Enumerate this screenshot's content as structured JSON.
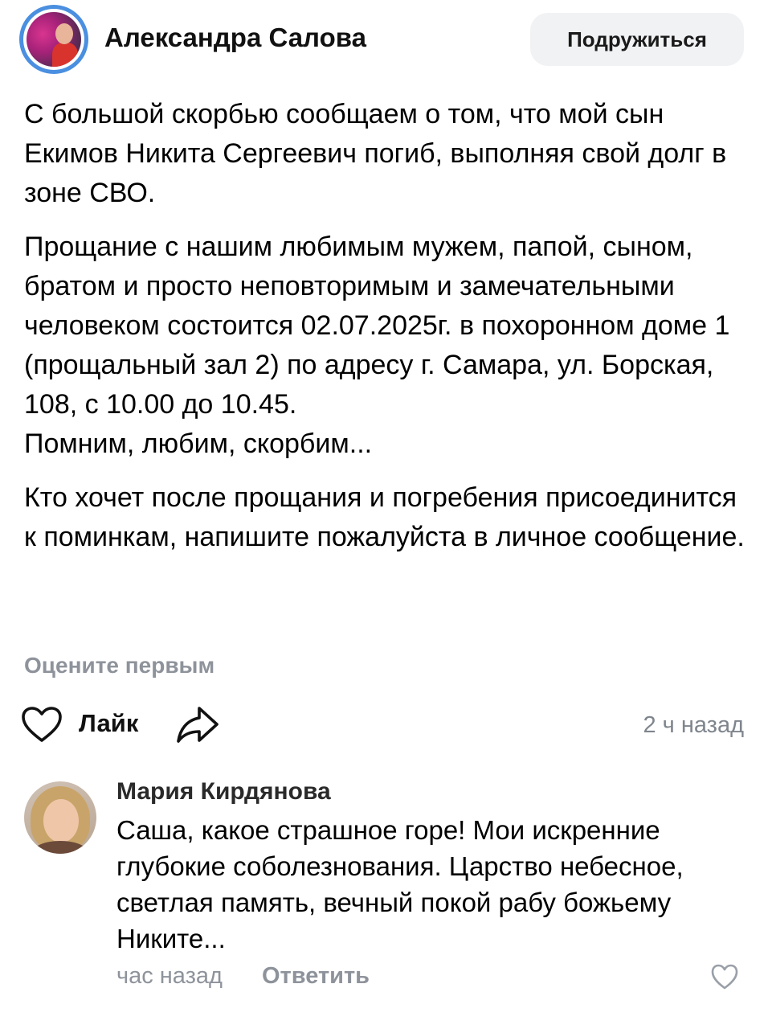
{
  "post": {
    "author": "Александра Салова",
    "friend_button": "Подружиться",
    "paragraphs": [
      "С большой скорбью сообщаем о том, что мой сын Екимов Никита Сергеевич погиб, выполняя свой долг в зоне СВО.",
      "Прощание с нашим любимым мужем, папой, сыном, братом и просто неповторимым и замечательными человеком состоится 02.07.2025г. в похоронном доме 1 (прощальный зал 2) по адресу г. Самара, ул. Борская, 108, с 10.00 до 10.45.",
      "Помним, любим, скорбим...",
      "Кто хочет после прощания и погребения присоединится к поминкам, напишите пожалуйста в личное сообщение."
    ],
    "rate_prompt": "Оцените первым",
    "like_label": "Лайк",
    "time": "2 ч назад"
  },
  "comment": {
    "author": "Мария Кирдянова",
    "text": "Саша, какое страшное горе! Мои искренние глубокие соболезнования. Царство небесное, светлая память, вечный покой рабу божьему Никите...",
    "time": "час назад",
    "reply_label": "Ответить"
  },
  "icons": {
    "author_avatar": "avatar-photo",
    "like": "heart-outline-icon",
    "share": "share-arrow-icon",
    "comment_like": "heart-outline-icon"
  },
  "colors": {
    "avatar_ring": "#4a8fe0",
    "button_bg": "#f1f2f4",
    "muted_text": "#8e939b"
  }
}
